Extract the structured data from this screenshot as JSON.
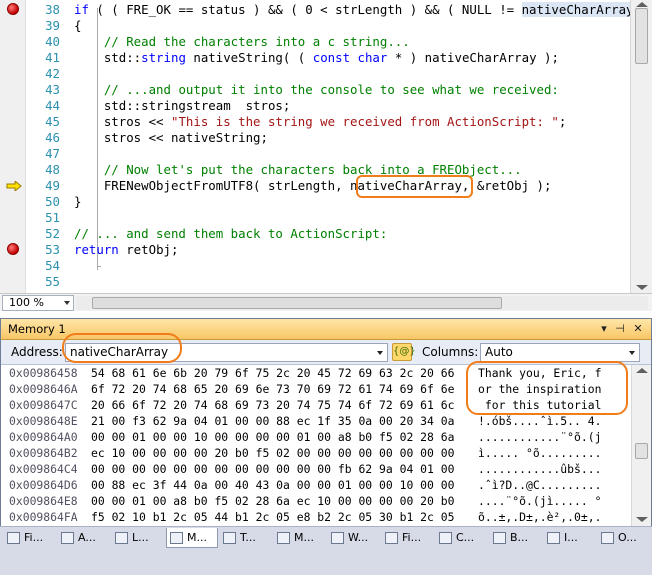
{
  "editor": {
    "lines": [
      {
        "n": "38",
        "html": "<span class='kw'>if</span> ( ( FRE_OK == status ) &amp;&amp; ( 0 &lt; strLength ) &amp;&amp; ( NULL != <span class='hl-word'>nativeCharArray</span>"
      },
      {
        "n": "39",
        "html": "{"
      },
      {
        "n": "40",
        "html": "    <span class='cm'>// Read the characters into a c string...</span>"
      },
      {
        "n": "41",
        "html": "    std::<span class='kw'>string</span> nativeString( ( <span class='kw'>const</span> <span class='kw'>char</span> * ) nativeCharArray );"
      },
      {
        "n": "42",
        "html": ""
      },
      {
        "n": "43",
        "html": "    <span class='cm'>// ...and output it into the console to see what we received:</span>"
      },
      {
        "n": "44",
        "html": "    std::stringstream  stros;"
      },
      {
        "n": "45",
        "html": "    stros &lt;&lt; <span class='str'>\"This is the string we received from ActionScript: \"</span>;"
      },
      {
        "n": "46",
        "html": "    stros &lt;&lt; nativeString;"
      },
      {
        "n": "47",
        "html": ""
      },
      {
        "n": "48",
        "html": "    <span class='cm'>// Now let's put the characters back into a FREObject...</span>"
      },
      {
        "n": "49",
        "html": "    FRENewObjectFromUTF8( strLength, nativeCharArray, &amp;retObj );"
      },
      {
        "n": "50",
        "html": "}"
      },
      {
        "n": "51",
        "html": ""
      },
      {
        "n": "52",
        "html": "<span class='cm'>// ... and send them back to ActionScript:</span>"
      },
      {
        "n": "53",
        "html": "<span class='kw'>return</span> retObj;"
      },
      {
        "n": "54",
        "html": ""
      },
      {
        "n": "55",
        "html": ""
      }
    ],
    "breakpoint_lines": [
      "38",
      "53"
    ],
    "current_line": "49",
    "zoom": "100 %"
  },
  "memory": {
    "title": "Memory 1",
    "address_label": "Address:",
    "address_value": "nativeCharArray",
    "columns_label": "Columns:",
    "columns_value": "Auto",
    "reevaluate_icon": "reevaluate-icon",
    "rows": [
      {
        "addr": "0x00986458",
        "bytes": "54 68 61 6e 6b 20 79 6f 75 2c 20 45 72 69 63 2c 20 66",
        "ascii": "Thank you, Eric, f"
      },
      {
        "addr": "0x0098646A",
        "bytes": "6f 72 20 74 68 65 20 69 6e 73 70 69 72 61 74 69 6f 6e",
        "ascii": "or the inspiration"
      },
      {
        "addr": "0x0098647C",
        "bytes": "20 66 6f 72 20 74 68 69 73 20 74 75 74 6f 72 69 61 6c",
        "ascii": " for this tutorial"
      },
      {
        "addr": "0x0098648E",
        "bytes": "21 00 f3 62 9a 04 01 00 00 88 ec 1f 35 0a 00 20 34 0a",
        "ascii": "!.óbš....ˆì.5.. 4."
      },
      {
        "addr": "0x009864A0",
        "bytes": "00 00 01 00 00 10 00 00 00 00 01 00 a8 b0 f5 02 28 6a",
        "ascii": "............¨°õ.(j"
      },
      {
        "addr": "0x009864B2",
        "bytes": "ec 10 00 00 00 00 20 b0 f5 02 00 00 00 00 00 00 00 00",
        "ascii": "ì..... °õ........."
      },
      {
        "addr": "0x009864C4",
        "bytes": "00 00 00 00 00 00 00 00 00 00 00 00 fb 62 9a 04 01 00",
        "ascii": "............ûbš..."
      },
      {
        "addr": "0x009864D6",
        "bytes": "00 88 ec 3f 44 0a 00 40 43 0a 00 00 01 00 00 10 00 00",
        "ascii": ".ˆì?D..@C........."
      },
      {
        "addr": "0x009864E8",
        "bytes": "00 00 01 00 a8 b0 f5 02 28 6a ec 10 00 00 00 00 20 b0",
        "ascii": "....¨°õ.(jì..... °"
      },
      {
        "addr": "0x009864FA",
        "bytes": "f5 02 10 b1 2c 05 44 b1 2c 05 e8 b2 2c 05 30 b1 2c 05",
        "ascii": "õ..±,.D±,.è²,.0±,."
      }
    ]
  },
  "tabs": [
    {
      "label": "Fi...",
      "icon": "binoculars-icon"
    },
    {
      "label": "A...",
      "icon": "autos-icon"
    },
    {
      "label": "L...",
      "icon": "locals-icon"
    },
    {
      "label": "M...",
      "icon": "memory-icon",
      "active": true
    },
    {
      "label": "T...",
      "icon": "threads-icon"
    },
    {
      "label": "M...",
      "icon": "modules-icon"
    },
    {
      "label": "W...",
      "icon": "watch-icon"
    },
    {
      "label": "Fi...",
      "icon": "find-results-icon"
    },
    {
      "label": "C...",
      "icon": "call-stack-icon"
    },
    {
      "label": "B...",
      "icon": "breakpoints-icon"
    },
    {
      "label": "I...",
      "icon": "immediate-icon"
    },
    {
      "label": "O...",
      "icon": "output-icon"
    }
  ],
  "colors": {
    "annotation": "#f07d1a",
    "keyword": "#0000ff",
    "comment": "#008000",
    "string": "#a31515",
    "line_number": "#2b91af",
    "panel_title": "#f8c766"
  }
}
